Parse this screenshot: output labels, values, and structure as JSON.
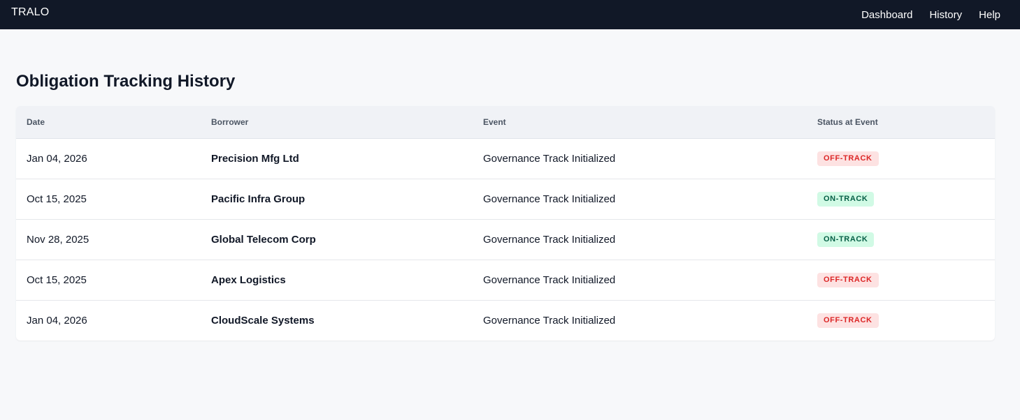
{
  "app": {
    "brand": "TRALO"
  },
  "nav": {
    "links": [
      "Dashboard",
      "History",
      "Help"
    ]
  },
  "page": {
    "title": "Obligation Tracking History"
  },
  "table": {
    "headers": [
      "Date",
      "Borrower",
      "Event",
      "Status at Event"
    ],
    "rows": [
      {
        "date": "Jan 04, 2026",
        "borrower": "Precision Mfg Ltd",
        "event": "Governance Track Initialized",
        "status": "OFF-TRACK",
        "status_type": "off"
      },
      {
        "date": "Oct 15, 2025",
        "borrower": "Pacific Infra Group",
        "event": "Governance Track Initialized",
        "status": "ON-TRACK",
        "status_type": "on"
      },
      {
        "date": "Nov 28, 2025",
        "borrower": "Global Telecom Corp",
        "event": "Governance Track Initialized",
        "status": "ON-TRACK",
        "status_type": "on"
      },
      {
        "date": "Oct 15, 2025",
        "borrower": "Apex Logistics",
        "event": "Governance Track Initialized",
        "status": "OFF-TRACK",
        "status_type": "off"
      },
      {
        "date": "Jan 04, 2026",
        "borrower": "CloudScale Systems",
        "event": "Governance Track Initialized",
        "status": "OFF-TRACK",
        "status_type": "off"
      }
    ]
  },
  "colors": {
    "nav_bg": "#111827",
    "off_track_bg": "#fde2e2",
    "off_track_text": "#dc2626",
    "on_track_bg": "#d1fae5",
    "on_track_text": "#065f46"
  }
}
